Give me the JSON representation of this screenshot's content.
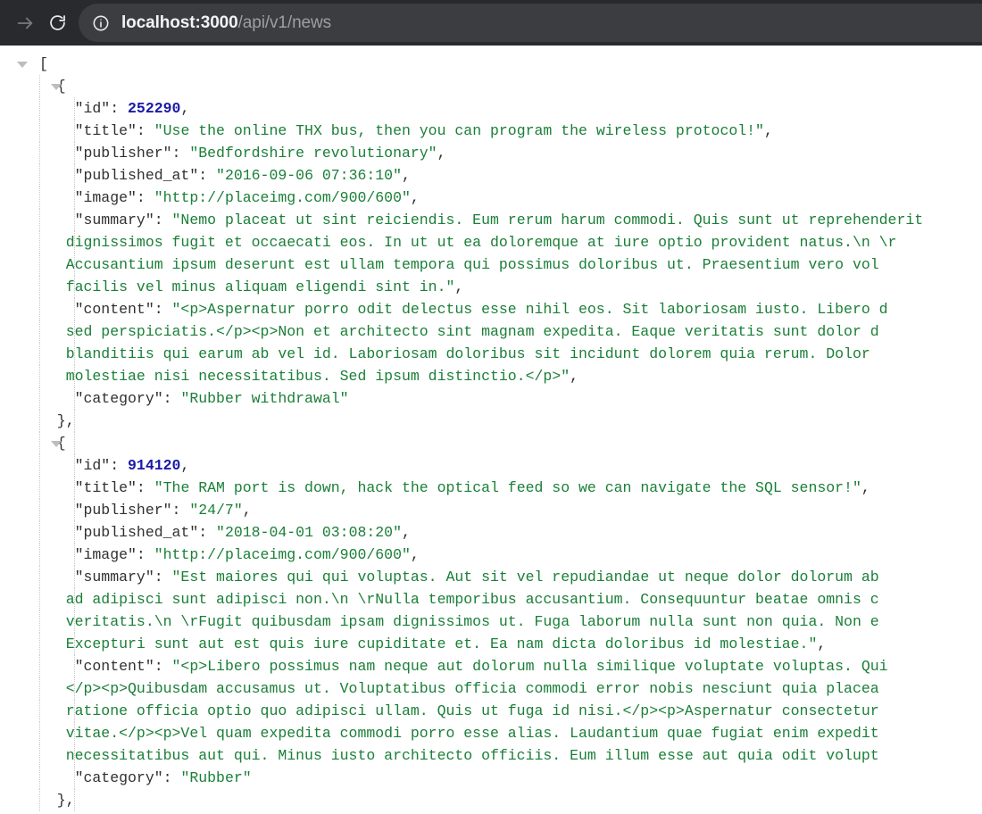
{
  "browser": {
    "toolbar": {
      "forward_button_label": "Forward",
      "reload_button_label": "Reload this page",
      "site_info_label": "View site information"
    },
    "omnibox": {
      "host": "localhost:3000",
      "path": "/api/v1/news",
      "full_url": "localhost:3000/api/v1/news"
    },
    "colors": {
      "toolbar_bg": "#292a2d",
      "omnibox_bg": "#3b3d40",
      "host_text": "#f1f3f4",
      "path_text": "#9aa0a6",
      "json_string": "#1a7f37",
      "json_number": "#1a1aa6",
      "json_key": "#303030"
    }
  },
  "json_viewer": {
    "root_open_bracket": "[",
    "lines": [
      {
        "indent": 0,
        "triangle": "t1",
        "text": "["
      },
      {
        "indent": 1,
        "triangle": "t2",
        "text": "  {"
      },
      {
        "indent": 2,
        "segments": [
          {
            "t": "    \"id\": ",
            "c": "k"
          },
          {
            "t": "252290",
            "c": "num"
          },
          {
            "t": ",",
            "c": "k"
          }
        ]
      },
      {
        "indent": 2,
        "segments": [
          {
            "t": "    \"title\": ",
            "c": "k"
          },
          {
            "t": "\"Use the online THX bus, then you can program the wireless protocol!\"",
            "c": "str"
          },
          {
            "t": ",",
            "c": "k"
          }
        ]
      },
      {
        "indent": 2,
        "segments": [
          {
            "t": "    \"publisher\": ",
            "c": "k"
          },
          {
            "t": "\"Bedfordshire revolutionary\"",
            "c": "str"
          },
          {
            "t": ",",
            "c": "k"
          }
        ]
      },
      {
        "indent": 2,
        "segments": [
          {
            "t": "    \"published_at\": ",
            "c": "k"
          },
          {
            "t": "\"2016-09-06 07:36:10\"",
            "c": "str"
          },
          {
            "t": ",",
            "c": "k"
          }
        ]
      },
      {
        "indent": 2,
        "segments": [
          {
            "t": "    \"image\": ",
            "c": "k"
          },
          {
            "t": "\"http://placeimg.com/900/600\"",
            "c": "str"
          },
          {
            "t": ",",
            "c": "k"
          }
        ]
      },
      {
        "indent": 2,
        "segments": [
          {
            "t": "    \"summary\": ",
            "c": "k"
          },
          {
            "t": "\"Nemo placeat ut sint reiciendis. Eum rerum harum commodi. Quis sunt ut reprehenderit",
            "c": "str"
          }
        ]
      },
      {
        "indent": 0,
        "raw": true,
        "segments": [
          {
            "t": "   dignissimos fugit et occaecati eos. In ut ut ea doloremque at iure optio provident natus.\\n \\r",
            "c": "str"
          }
        ]
      },
      {
        "indent": 0,
        "raw": true,
        "segments": [
          {
            "t": "   Accusantium ipsum deserunt est ullam tempora qui possimus doloribus ut. Praesentium vero vol",
            "c": "str"
          }
        ]
      },
      {
        "indent": 0,
        "raw": true,
        "segments": [
          {
            "t": "   facilis vel minus aliquam eligendi sint in.\"",
            "c": "str"
          },
          {
            "t": ",",
            "c": "k"
          }
        ]
      },
      {
        "indent": 2,
        "segments": [
          {
            "t": "    \"content\": ",
            "c": "k"
          },
          {
            "t": "\"<p>Aspernatur porro odit delectus esse nihil eos. Sit laboriosam iusto. Libero d",
            "c": "str"
          }
        ]
      },
      {
        "indent": 0,
        "raw": true,
        "segments": [
          {
            "t": "   sed perspiciatis.</p><p>Non et architecto sint magnam expedita. Eaque veritatis sunt dolor d",
            "c": "str"
          }
        ]
      },
      {
        "indent": 0,
        "raw": true,
        "segments": [
          {
            "t": "   blanditiis qui earum ab vel id. Laboriosam doloribus sit incidunt dolorem quia rerum. Dolor",
            "c": "str"
          }
        ]
      },
      {
        "indent": 0,
        "raw": true,
        "segments": [
          {
            "t": "   molestiae nisi necessitatibus. Sed ipsum distinctio.</p>\"",
            "c": "str"
          },
          {
            "t": ",",
            "c": "k"
          }
        ]
      },
      {
        "indent": 2,
        "segments": [
          {
            "t": "    \"category\": ",
            "c": "k"
          },
          {
            "t": "\"Rubber withdrawal\"",
            "c": "str"
          }
        ]
      },
      {
        "indent": 1,
        "text": "  },"
      },
      {
        "indent": 1,
        "triangle": "t2",
        "text": "  {"
      },
      {
        "indent": 2,
        "segments": [
          {
            "t": "    \"id\": ",
            "c": "k"
          },
          {
            "t": "914120",
            "c": "num"
          },
          {
            "t": ",",
            "c": "k"
          }
        ]
      },
      {
        "indent": 2,
        "segments": [
          {
            "t": "    \"title\": ",
            "c": "k"
          },
          {
            "t": "\"The RAM port is down, hack the optical feed so we can navigate the SQL sensor!\"",
            "c": "str"
          },
          {
            "t": ",",
            "c": "k"
          }
        ]
      },
      {
        "indent": 2,
        "segments": [
          {
            "t": "    \"publisher\": ",
            "c": "k"
          },
          {
            "t": "\"24/7\"",
            "c": "str"
          },
          {
            "t": ",",
            "c": "k"
          }
        ]
      },
      {
        "indent": 2,
        "segments": [
          {
            "t": "    \"published_at\": ",
            "c": "k"
          },
          {
            "t": "\"2018-04-01 03:08:20\"",
            "c": "str"
          },
          {
            "t": ",",
            "c": "k"
          }
        ]
      },
      {
        "indent": 2,
        "segments": [
          {
            "t": "    \"image\": ",
            "c": "k"
          },
          {
            "t": "\"http://placeimg.com/900/600\"",
            "c": "str"
          },
          {
            "t": ",",
            "c": "k"
          }
        ]
      },
      {
        "indent": 2,
        "segments": [
          {
            "t": "    \"summary\": ",
            "c": "k"
          },
          {
            "t": "\"Est maiores qui qui voluptas. Aut sit vel repudiandae ut neque dolor dolorum ab",
            "c": "str"
          }
        ]
      },
      {
        "indent": 0,
        "raw": true,
        "segments": [
          {
            "t": "   ad adipisci sunt adipisci non.\\n \\rNulla temporibus accusantium. Consequuntur beatae omnis c",
            "c": "str"
          }
        ]
      },
      {
        "indent": 0,
        "raw": true,
        "segments": [
          {
            "t": "   veritatis.\\n \\rFugit quibusdam ipsam dignissimos ut. Fuga laborum nulla sunt non quia. Non e",
            "c": "str"
          }
        ]
      },
      {
        "indent": 0,
        "raw": true,
        "segments": [
          {
            "t": "   Excepturi sunt aut est quis iure cupiditate et. Ea nam dicta doloribus id molestiae.\"",
            "c": "str"
          },
          {
            "t": ",",
            "c": "k"
          }
        ]
      },
      {
        "indent": 2,
        "segments": [
          {
            "t": "    \"content\": ",
            "c": "k"
          },
          {
            "t": "\"<p>Libero possimus nam neque aut dolorum nulla similique voluptate voluptas. Qui",
            "c": "str"
          }
        ]
      },
      {
        "indent": 0,
        "raw": true,
        "segments": [
          {
            "t": "   </p><p>Quibusdam accusamus ut. Voluptatibus officia commodi error nobis nesciunt quia placea",
            "c": "str"
          }
        ]
      },
      {
        "indent": 0,
        "raw": true,
        "segments": [
          {
            "t": "   ratione officia optio quo adipisci ullam. Quis ut fuga id nisi.</p><p>Aspernatur consectetur",
            "c": "str"
          }
        ]
      },
      {
        "indent": 0,
        "raw": true,
        "segments": [
          {
            "t": "   vitae.</p><p>Vel quam expedita commodi porro esse alias. Laudantium quae fugiat enim expedit",
            "c": "str"
          }
        ]
      },
      {
        "indent": 0,
        "raw": true,
        "segments": [
          {
            "t": "   necessitatibus aut qui. Minus iusto architecto officiis. Eum illum esse aut quia odit volupt",
            "c": "str"
          }
        ]
      },
      {
        "indent": 2,
        "segments": [
          {
            "t": "    \"category\": ",
            "c": "k"
          },
          {
            "t": "\"Rubber\"",
            "c": "str"
          }
        ]
      },
      {
        "indent": 1,
        "text": "  },"
      }
    ]
  }
}
